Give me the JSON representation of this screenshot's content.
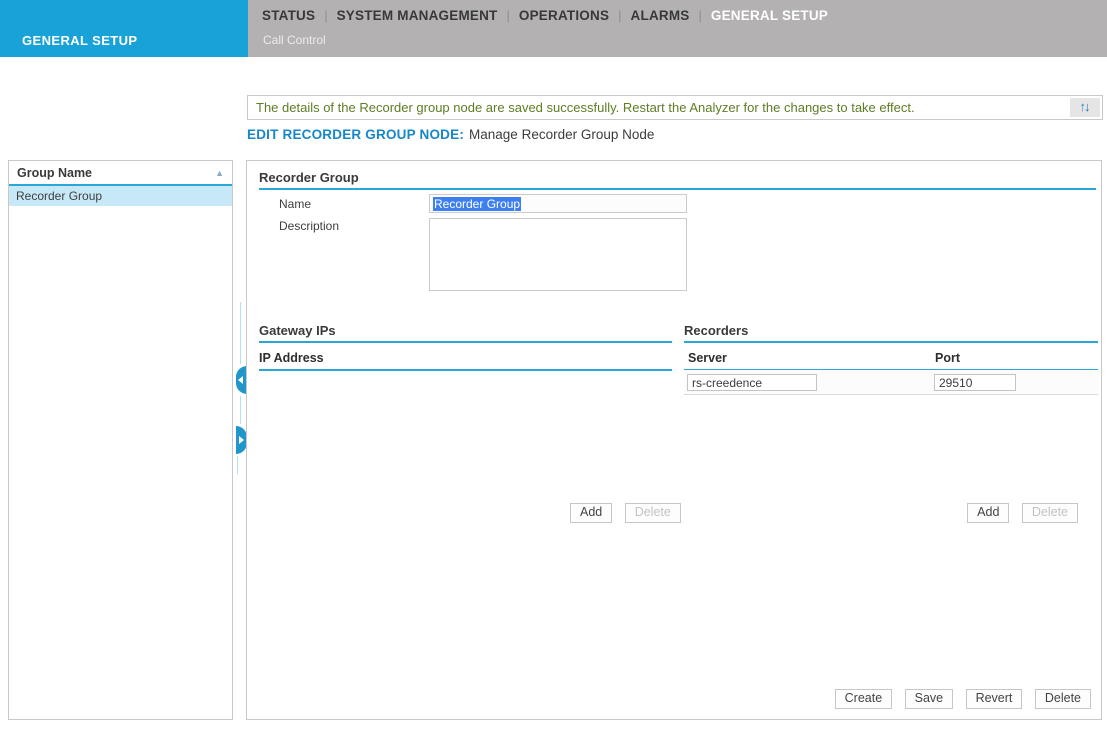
{
  "header": {
    "brand": "GENERAL SETUP",
    "tab_separator": "|",
    "tabs": [
      {
        "label": "STATUS",
        "active": false
      },
      {
        "label": "SYSTEM MANAGEMENT",
        "active": false
      },
      {
        "label": "OPERATIONS",
        "active": false
      },
      {
        "label": "ALARMS",
        "active": false
      },
      {
        "label": "GENERAL SETUP",
        "active": true
      }
    ],
    "subtab": "Call Control"
  },
  "message_bar": {
    "text": "The details of the Recorder group node are saved successfully. Restart the Analyzer for the changes to take effect.",
    "icon_up": "↑",
    "icon_down": "↓"
  },
  "page_heading": {
    "title": "EDIT RECORDER GROUP NODE:",
    "subtitle": "Manage Recorder Group Node"
  },
  "group_list": {
    "header": "Group Name",
    "sort_icon": "▲",
    "items": [
      {
        "name": "Recorder Group",
        "selected": true
      }
    ]
  },
  "form": {
    "section_title": "Recorder Group",
    "name_label": "Name",
    "name_value": "Recorder Group",
    "description_label": "Description",
    "description_value": "",
    "gateway": {
      "title": "Gateway IPs",
      "column": "IP Address",
      "rows": [],
      "add_label": "Add",
      "delete_label": "Delete",
      "delete_disabled": true
    },
    "recorders": {
      "title": "Recorders",
      "columns": {
        "server": "Server",
        "port": "Port"
      },
      "rows": [
        {
          "server": "rs-creedence",
          "port": "29510"
        }
      ],
      "add_label": "Add",
      "delete_label": "Delete",
      "delete_disabled": true
    },
    "actions": [
      "Create",
      "Save",
      "Revert",
      "Delete"
    ]
  },
  "colors": {
    "accent_cyan": "#18a2d8",
    "nav_gray": "#b3b1b1",
    "success_green": "#5d7d24",
    "heading_blue": "#1687ca",
    "selection_blue": "#3e7ff0",
    "selected_row_blue": "#c7e8f7",
    "handle_blue": "#2196ca"
  }
}
